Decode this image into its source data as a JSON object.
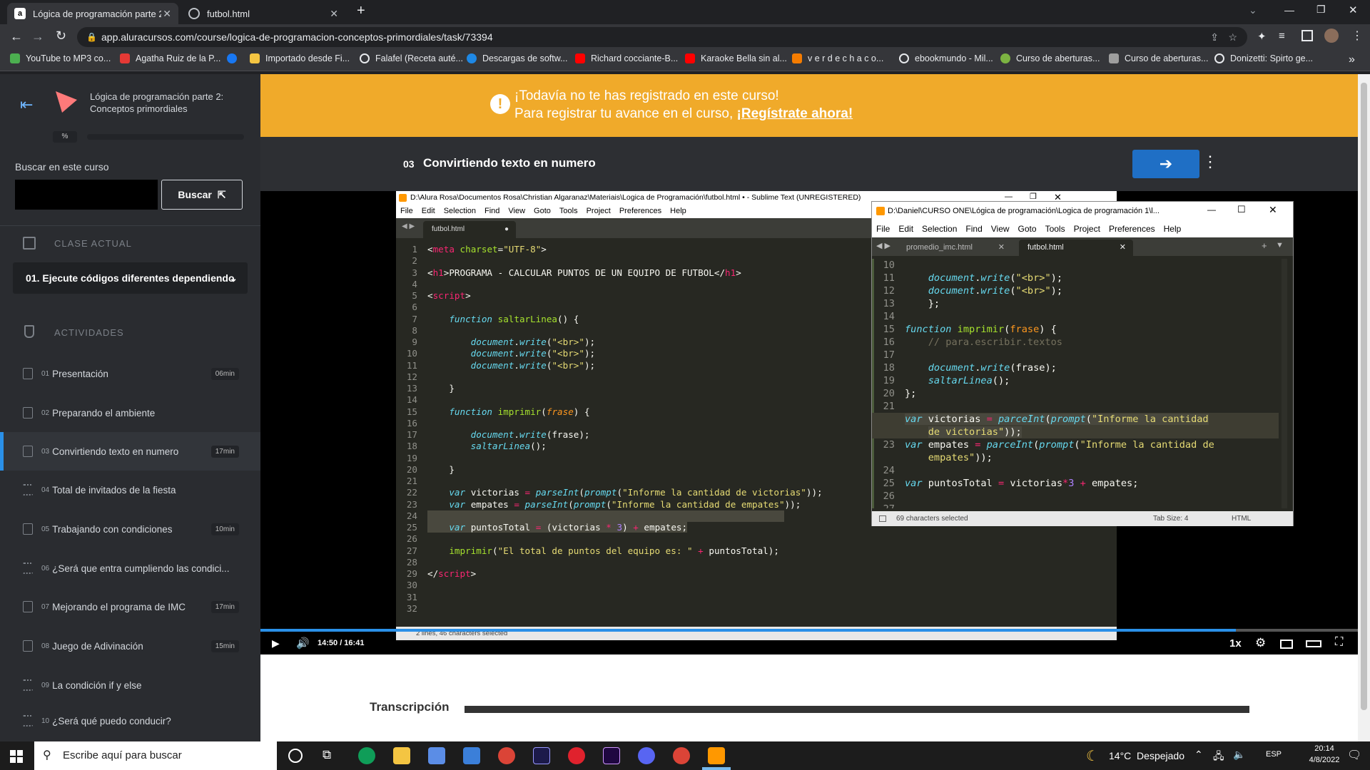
{
  "browser": {
    "tabs": [
      {
        "title": "Lógica de programación parte 2:",
        "active": true
      },
      {
        "title": "futbol.html",
        "active": false
      }
    ],
    "url": "app.aluracursos.com/course/logica-de-programacion-conceptos-primordiales/task/73394",
    "bookmarks": [
      "YouTube to MP3 co...",
      "Agatha Ruiz de la P...",
      "Importado desde Fi...",
      "Falafel (Receta auté...",
      "Descargas de softw...",
      "Richard cocciante-B...",
      "Karaoke Bella sin al...",
      "v e r d e c h a c o...",
      "ebookmundo - Mil...",
      "Curso de aberturas...",
      "Curso de aberturas...",
      "Donizetti: Spirto ge..."
    ]
  },
  "sidebar": {
    "course_title_1": "Lógica de programación parte 2:",
    "course_title_2": "Conceptos primordiales",
    "progress_label": "%",
    "search_label": "Buscar en este curso",
    "search_value": "",
    "search_button": "Buscar",
    "current_class_label": "CLASE ACTUAL",
    "current_class_value": "01. Ejecute códigos diferentes dependiendo",
    "activities_label": "ACTIVIDADES",
    "activities": [
      {
        "num": "01",
        "title": "Presentación",
        "duration": "06min"
      },
      {
        "num": "02",
        "title": "Preparando el ambiente",
        "duration": ""
      },
      {
        "num": "03",
        "title": "Convirtiendo texto en numero",
        "duration": "17min"
      },
      {
        "num": "04",
        "title": "Total de invitados de la fiesta",
        "duration": ""
      },
      {
        "num": "05",
        "title": "Trabajando con condiciones",
        "duration": "10min"
      },
      {
        "num": "06",
        "title": "¿Será que entra cumpliendo las condici...",
        "duration": ""
      },
      {
        "num": "07",
        "title": "Mejorando el programa de IMC",
        "duration": "17min"
      },
      {
        "num": "08",
        "title": "Juego de Adivinación",
        "duration": "15min"
      },
      {
        "num": "09",
        "title": "La condición if y else",
        "duration": ""
      },
      {
        "num": "10",
        "title": "¿Será qué puedo conducir?",
        "duration": ""
      }
    ]
  },
  "banner": {
    "line1": "¡Todavía no te has registrado en este curso!",
    "line2": "Para registrar tu avance en el curso, ",
    "link": "¡Regístrate ahora!"
  },
  "lesson": {
    "num": "03",
    "title": "Convirtiendo texto en numero"
  },
  "editor1": {
    "title": "D:\\Alura Rosa\\Documentos Rosa\\Christian Algaranaz\\Materiais\\Logica de Programación\\futbol.html • - Sublime Text (UNREGISTERED)",
    "menu": [
      "File",
      "Edit",
      "Selection",
      "Find",
      "View",
      "Goto",
      "Tools",
      "Project",
      "Preferences",
      "Help"
    ],
    "tab": "futbol.html",
    "status": "2 lines, 46 characters selected"
  },
  "editor2": {
    "title": "D:\\Daniel\\CURSO ONE\\Lógica de programación\\Logica de programación 1\\l...",
    "menu": [
      "File",
      "Edit",
      "Selection",
      "Find",
      "View",
      "Goto",
      "Tools",
      "Project",
      "Preferences",
      "Help"
    ],
    "tabs": [
      "promedio_imc.html",
      "futbol.html"
    ],
    "status_left": "69 characters selected",
    "status_tab": "Tab Size: 4",
    "status_syntax": "HTML"
  },
  "player": {
    "time": "14:50 / 16:41",
    "speed": "1x"
  },
  "transcript": {
    "title": "Transcripción"
  },
  "taskbar": {
    "search_placeholder": "Escribe aquí para buscar",
    "weather": "14°C  Despejado",
    "lang": "ESP",
    "time": "20:14",
    "date": "4/8/2022"
  }
}
